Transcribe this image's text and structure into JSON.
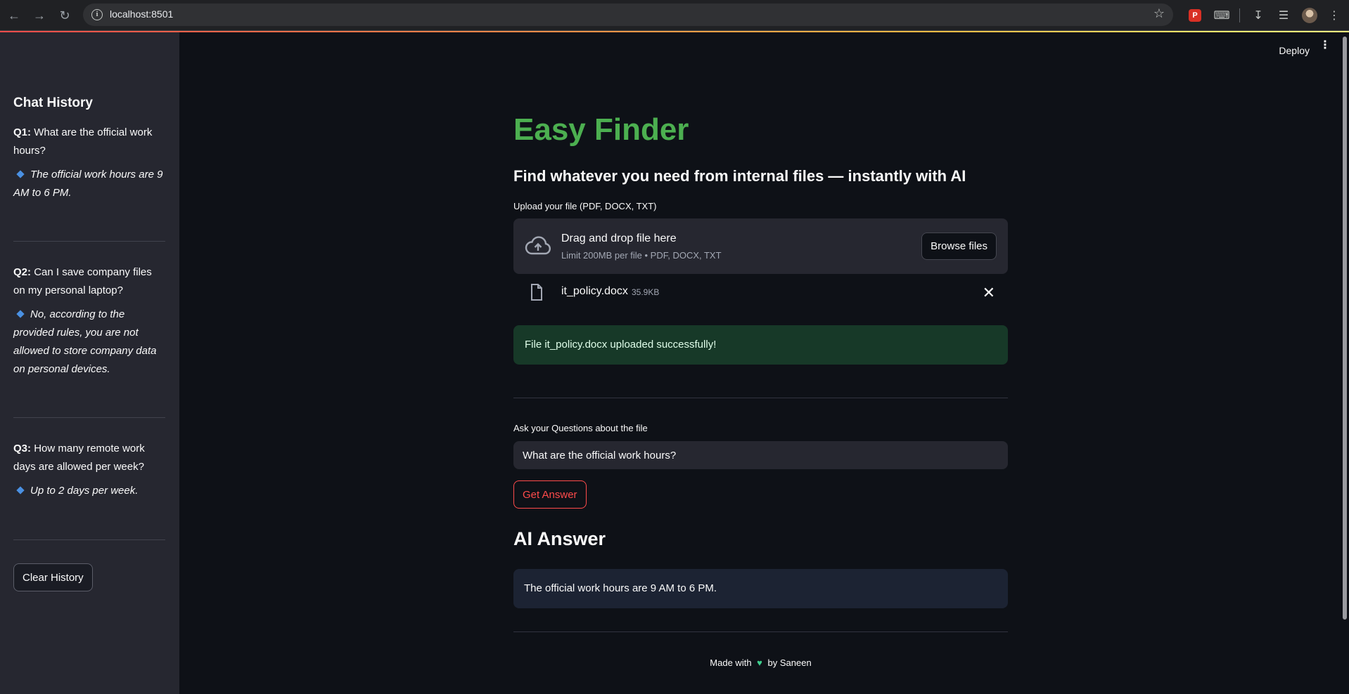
{
  "browser": {
    "url": "localhost:8501"
  },
  "header": {
    "deploy_label": "Deploy"
  },
  "sidebar": {
    "title": "Chat History",
    "items": [
      {
        "q_prefix": "Q1:",
        "question": "What are the official work hours?",
        "answer": "The official work hours are 9 AM to 6 PM."
      },
      {
        "q_prefix": "Q2:",
        "question": "Can I save company files on my personal laptop?",
        "answer": "No, according to the provided rules, you are not allowed to store company data on personal devices."
      },
      {
        "q_prefix": "Q3:",
        "question": "How many remote work days are allowed per week?",
        "answer": "Up to 2 days per week."
      }
    ],
    "clear_label": "Clear History"
  },
  "main": {
    "title": "Easy Finder",
    "subtitle": "Find whatever you need from internal files — instantly with AI",
    "upload_label": "Upload your file (PDF, DOCX, TXT)",
    "drop_text": "Drag and drop file here",
    "limit_text": "Limit 200MB per file • PDF, DOCX, TXT",
    "browse_label": "Browse files",
    "file": {
      "name": "it_policy.docx",
      "size": "35.9KB"
    },
    "success_text": "File it_policy.docx uploaded successfully!",
    "question_label": "Ask your Questions about the file",
    "question_value": "What are the official work hours?",
    "get_answer_label": "Get Answer",
    "ai_heading": "AI Answer",
    "ai_answer": "The official work hours are 9 AM to 6 PM.",
    "footer_pre": "Made with",
    "footer_post": "by Saneen"
  },
  "colors": {
    "title_green": "#4caf50",
    "accent_red": "#ff4b4b",
    "heart": "#3ecf8e"
  }
}
